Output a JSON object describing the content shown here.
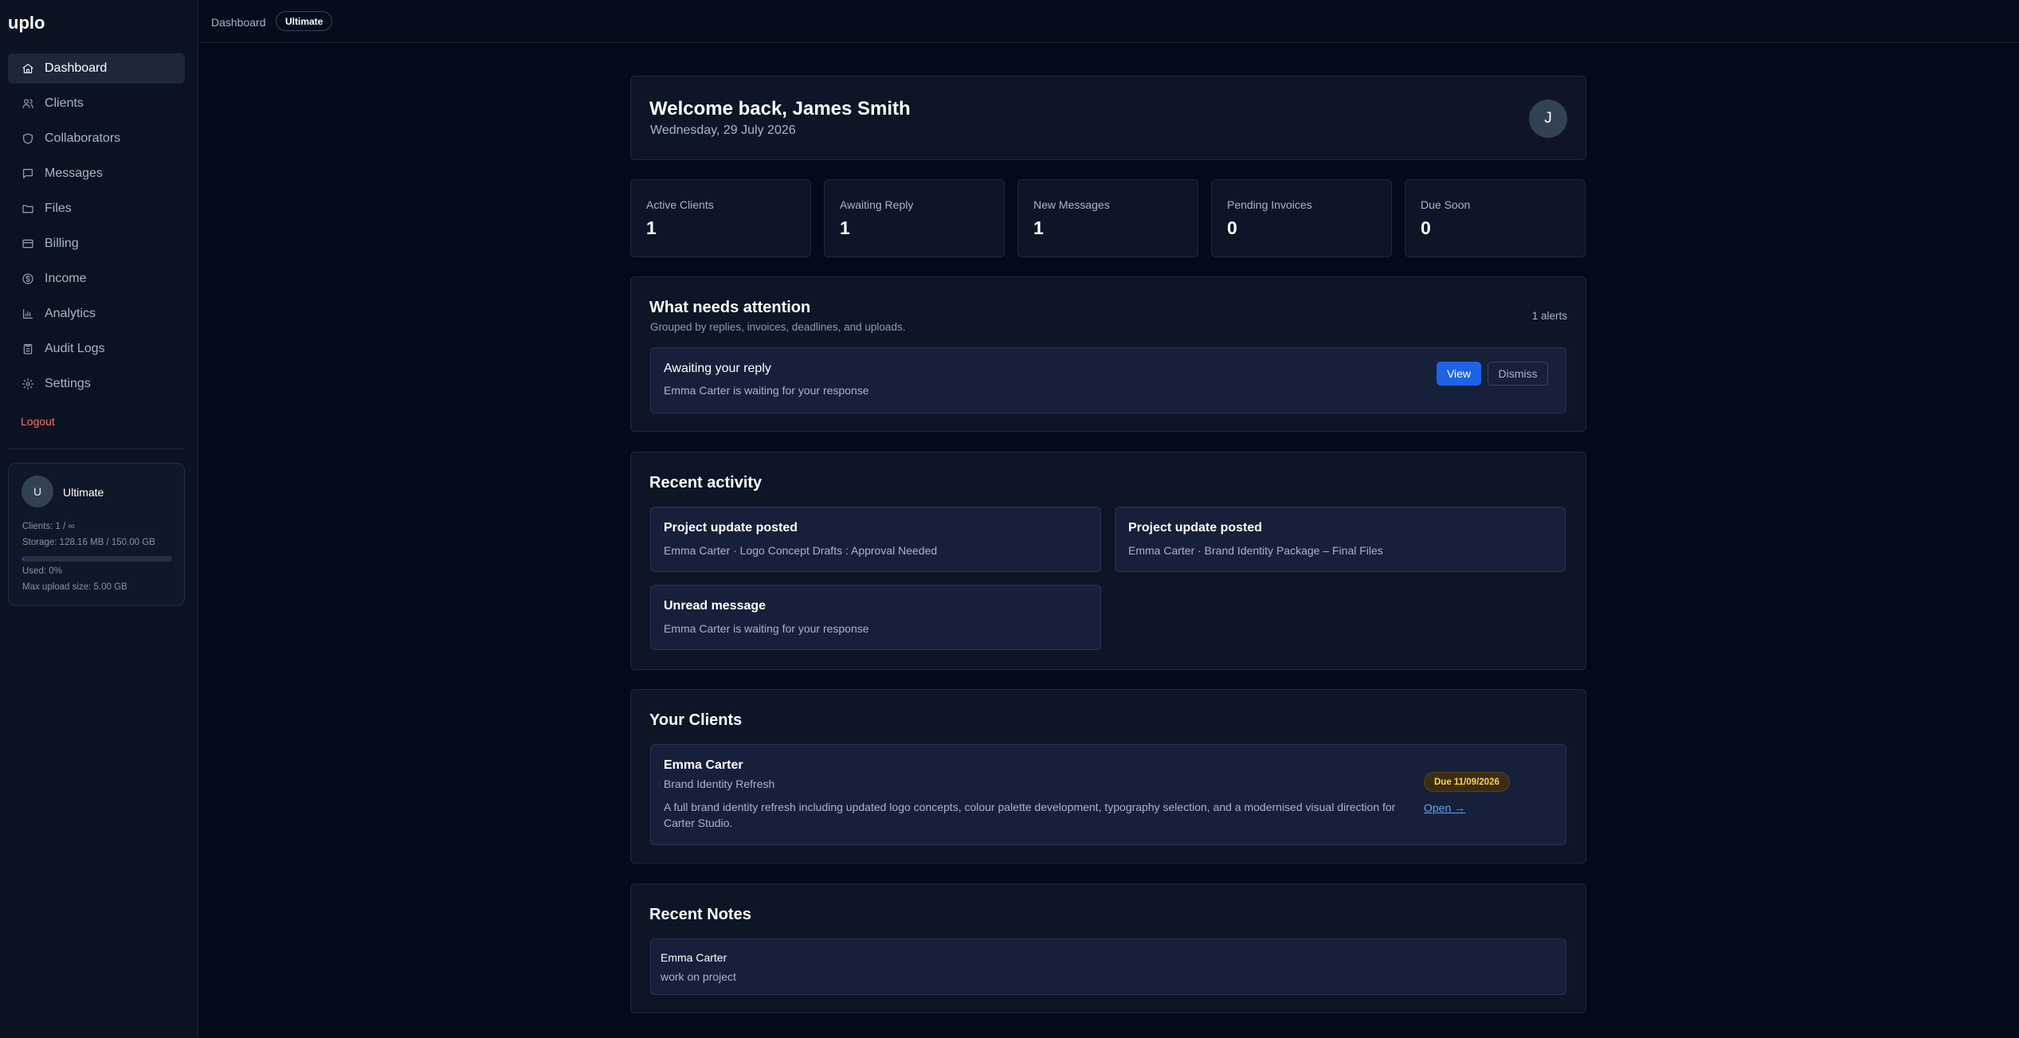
{
  "app": {
    "name": "uplo"
  },
  "sidebar": {
    "items": [
      {
        "label": "Dashboard",
        "icon": "home-icon",
        "active": true
      },
      {
        "label": "Clients",
        "icon": "users-icon"
      },
      {
        "label": "Collaborators",
        "icon": "shield-icon"
      },
      {
        "label": "Messages",
        "icon": "message-icon"
      },
      {
        "label": "Files",
        "icon": "folder-icon"
      },
      {
        "label": "Billing",
        "icon": "credit-card-icon"
      },
      {
        "label": "Income",
        "icon": "dollar-circle-icon"
      },
      {
        "label": "Analytics",
        "icon": "bar-chart-icon"
      },
      {
        "label": "Audit Logs",
        "icon": "clipboard-icon"
      },
      {
        "label": "Settings",
        "icon": "gear-icon"
      }
    ],
    "logout": "Logout",
    "plan": {
      "avatar": "U",
      "name": "Ultimate",
      "clients": "Clients: 1 / ∞",
      "storage": "Storage: 128.16 MB / 150.00 GB",
      "used": "Used: 0%",
      "used_fraction": 0.001,
      "max_upload": "Max upload size: 5.00 GB"
    }
  },
  "topbar": {
    "breadcrumb": "Dashboard",
    "plan_badge": "Ultimate"
  },
  "welcome": {
    "title": "Welcome back, James Smith",
    "date": "Wednesday, 29 July 2026",
    "avatar": "J"
  },
  "stats": [
    {
      "label": "Active Clients",
      "value": "1"
    },
    {
      "label": "Awaiting Reply",
      "value": "1"
    },
    {
      "label": "New Messages",
      "value": "1"
    },
    {
      "label": "Pending Invoices",
      "value": "0"
    },
    {
      "label": "Due Soon",
      "value": "0"
    }
  ],
  "attention": {
    "title": "What needs attention",
    "subtitle": "Grouped by replies, invoices, deadlines, and uploads.",
    "count": "1 alerts",
    "alert": {
      "title": "Awaiting your reply",
      "description": "Emma Carter is waiting for your response",
      "view_label": "View",
      "dismiss_label": "Dismiss"
    }
  },
  "activity": {
    "title": "Recent activity",
    "items": [
      {
        "title": "Project update posted",
        "description": "Emma Carter · Logo Concept Drafts : Approval Needed"
      },
      {
        "title": "Project update posted",
        "description": "Emma Carter · Brand Identity Package – Final Files"
      },
      {
        "title": "Unread message",
        "description": "Emma Carter is waiting for your response"
      }
    ]
  },
  "clients": {
    "title": "Your Clients",
    "items": [
      {
        "name": "Emma Carter",
        "project": "Brand Identity Refresh",
        "description": "A full brand identity refresh including updated logo concepts, colour palette development, typography selection, and a modernised visual direction for Carter Studio.",
        "due": "Due 11/09/2026",
        "open_label": "Open →"
      }
    ]
  },
  "notes": {
    "title": "Recent Notes",
    "items": [
      {
        "name": "Emma Carter",
        "text": "work on project"
      }
    ]
  },
  "colors": {
    "accent": "#1d63e8",
    "logout": "#f87171",
    "due_badge": "#fcd34d"
  }
}
